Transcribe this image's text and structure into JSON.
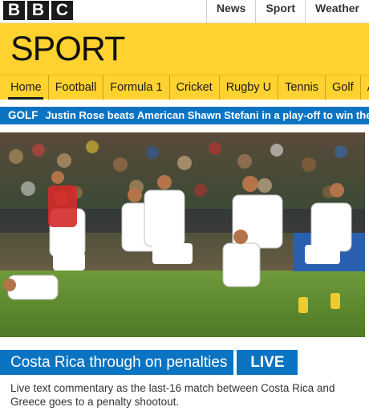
{
  "header": {
    "logo_letters": [
      "B",
      "B",
      "C"
    ],
    "links": [
      "News",
      "Sport",
      "Weather"
    ]
  },
  "banner": {
    "title": "SPORT"
  },
  "nav": {
    "items": [
      "Home",
      "Football",
      "Formula 1",
      "Cricket",
      "Rugby U",
      "Tennis",
      "Golf",
      "A"
    ],
    "active_index": 0
  },
  "ticker": {
    "label": "GOLF",
    "text": "Justin Rose beats American Shawn Stefani in a play-off to win the Quic"
  },
  "story": {
    "headline": "Costa Rica through on penalties",
    "live_label": "LIVE",
    "summary": "Live text commentary as the last-16 match between Costa Rica and Greece goes to a penalty shootout."
  },
  "colors": {
    "brand_yellow": "#ffd230",
    "accent_blue": "#0b74c2",
    "logo_black": "#1b1b1b"
  }
}
